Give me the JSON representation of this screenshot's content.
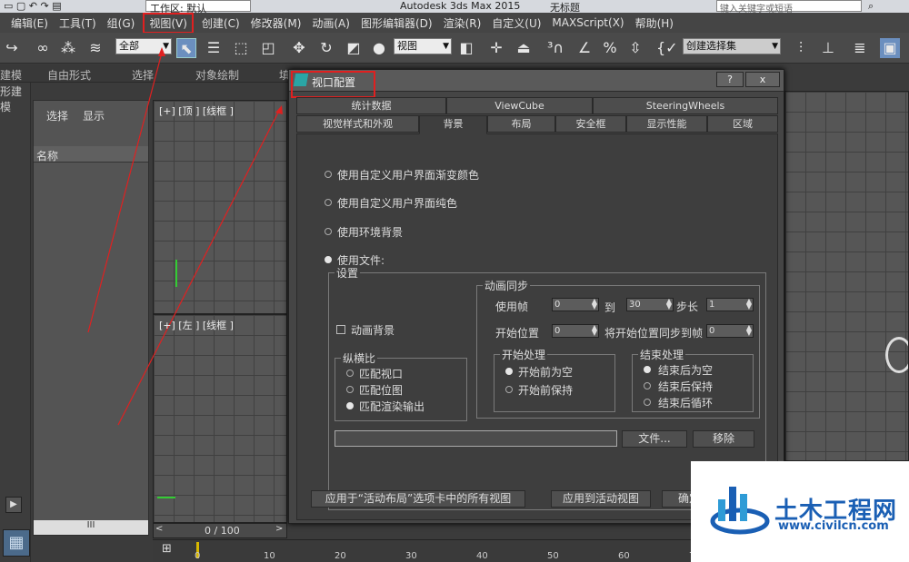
{
  "titlebar": {
    "workspace_label": "工作区: 默认",
    "app_title": "Autodesk 3ds Max  2015",
    "doc_title": "无标题",
    "search_placeholder": "键入关键字或短语"
  },
  "menubar": {
    "items": [
      "编辑(E)",
      "工具(T)",
      "组(G)",
      "视图(V)",
      "创建(C)",
      "修改器(M)",
      "动画(A)",
      "图形编辑器(D)",
      "渲染(R)",
      "自定义(U)",
      "MAXScript(X)",
      "帮助(H)"
    ]
  },
  "toolbar": {
    "filter_select": "全部",
    "view_select": "视图",
    "selection_set": "创建选择集"
  },
  "ribbon": {
    "tabs": [
      "建模",
      "自由形式",
      "选择",
      "对象绘制",
      "填"
    ]
  },
  "ribbon_sub": "形建模",
  "panel": {
    "tab_select": "选择",
    "tab_display": "显示",
    "column_name": "名称",
    "scroll_label": "III"
  },
  "viewports": {
    "top_label": "[+] [顶 ] [线框 ]",
    "left_label": "[+] [左 ] [线框 ]"
  },
  "timeline": {
    "frame_counter": "0 / 100",
    "ticks": [
      "0",
      "10",
      "20",
      "30",
      "40",
      "50",
      "60",
      "70"
    ]
  },
  "dialog": {
    "title": "视口配置",
    "help_btn": "?",
    "close_btn": "x",
    "tabs_row1": [
      "统计数据",
      "ViewCube",
      "SteeringWheels"
    ],
    "tabs_row2": [
      "视觉样式和外观",
      "背景",
      "布局",
      "安全框",
      "显示性能",
      "区域"
    ],
    "active_tab": "背景",
    "bg_options": [
      "使用自定义用户界面渐变颜色",
      "使用自定义用户界面纯色",
      "使用环境背景",
      "使用文件:"
    ],
    "settings_group": "设置",
    "anim_sync_group": "动画同步",
    "use_frame_label": "使用帧",
    "use_frame_from": "0",
    "to_label": "到",
    "use_frame_to": "30",
    "step_label": "步长",
    "step_value": "1",
    "start_pos_label": "开始位置",
    "start_pos_value": "0",
    "sync_start_label": "将开始位置同步到帧",
    "sync_start_value": "0",
    "anim_bg_label": "动画背景",
    "aspect_group": "纵横比",
    "aspect_options": [
      "匹配视口",
      "匹配位图",
      "匹配渲染输出"
    ],
    "start_proc_group": "开始处理",
    "start_proc_options": [
      "开始前为空",
      "开始前保持"
    ],
    "end_proc_group": "结束处理",
    "end_proc_options": [
      "结束后为空",
      "结束后保持",
      "结束后循环"
    ],
    "file_path": "",
    "file_btn": "文件...",
    "remove_btn": "移除",
    "apply_all_btn": "应用于“活动布局”选项卡中的所有视图",
    "apply_active_btn": "应用到活动视图",
    "ok_btn": "确定"
  },
  "watermark": {
    "brand": "土木工程网",
    "url": "www.civilcn.com"
  },
  "colors": {
    "highlight_red": "#e02020",
    "watermark_blue": "#1a5fb4"
  }
}
